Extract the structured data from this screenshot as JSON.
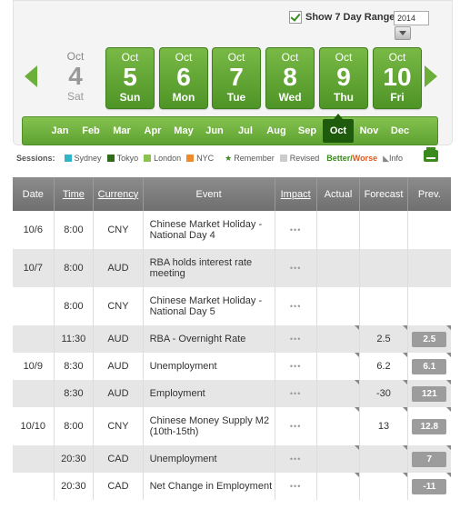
{
  "header": {
    "show7_label": "Show 7 Day Range",
    "year": "2014"
  },
  "days": [
    {
      "month": "Oct",
      "num": "4",
      "dow": "Sat",
      "active": false
    },
    {
      "month": "Oct",
      "num": "5",
      "dow": "Sun",
      "active": true
    },
    {
      "month": "Oct",
      "num": "6",
      "dow": "Mon",
      "active": true
    },
    {
      "month": "Oct",
      "num": "7",
      "dow": "Tue",
      "active": true
    },
    {
      "month": "Oct",
      "num": "8",
      "dow": "Wed",
      "active": true
    },
    {
      "month": "Oct",
      "num": "9",
      "dow": "Thu",
      "active": true
    },
    {
      "month": "Oct",
      "num": "10",
      "dow": "Fri",
      "active": true
    }
  ],
  "months": [
    "Jan",
    "Feb",
    "Mar",
    "Apr",
    "May",
    "Jun",
    "Jul",
    "Aug",
    "Sep",
    "Oct",
    "Nov",
    "Dec"
  ],
  "selected_month_index": 9,
  "legend": {
    "sessions_label": "Sessions:",
    "sessions": [
      {
        "name": "Sydney",
        "color": "#33b5c9"
      },
      {
        "name": "Tokyo",
        "color": "#2f6b1b"
      },
      {
        "name": "London",
        "color": "#8cc34f"
      },
      {
        "name": "NYC",
        "color": "#f08a2c"
      }
    ],
    "remember": "Remember",
    "revised": "Revised",
    "better": "Better",
    "slash": " / ",
    "worse": "Worse",
    "info": "Info"
  },
  "table": {
    "columns": [
      "Date",
      "Time",
      "Currency",
      "Event",
      "Impact",
      "Actual",
      "Forecast",
      "Prev."
    ],
    "rows": [
      {
        "date": "10/6",
        "time": "8:00",
        "currency": "CNY",
        "event": "Chinese Market Holiday - National Day 4",
        "impact": "•••",
        "actual": "",
        "forecast": "",
        "prev": ""
      },
      {
        "date": "10/7",
        "time": "8:00",
        "currency": "AUD",
        "event": "RBA holds interest rate meeting",
        "impact": "•••",
        "actual": "",
        "forecast": "",
        "prev": ""
      },
      {
        "date": "",
        "time": "8:00",
        "currency": "CNY",
        "event": "Chinese Market Holiday - National Day 5",
        "impact": "•••",
        "actual": "",
        "forecast": "",
        "prev": ""
      },
      {
        "date": "",
        "time": "11:30",
        "currency": "AUD",
        "event": "RBA - Overnight Rate",
        "impact": "•••",
        "actual": "",
        "forecast": "2.5",
        "prev": "2.5"
      },
      {
        "date": "10/9",
        "time": "8:30",
        "currency": "AUD",
        "event": "Unemployment",
        "impact": "•••",
        "actual": "",
        "forecast": "6.2",
        "prev": "6.1"
      },
      {
        "date": "",
        "time": "8:30",
        "currency": "AUD",
        "event": "Employment",
        "impact": "•••",
        "actual": "",
        "forecast": "-30",
        "prev": "121"
      },
      {
        "date": "10/10",
        "time": "8:00",
        "currency": "CNY",
        "event": "Chinese Money Supply M2 (10th-15th)",
        "impact": "•••",
        "actual": "",
        "forecast": "13",
        "prev": "12.8"
      },
      {
        "date": "",
        "time": "20:30",
        "currency": "CAD",
        "event": "Unemployment",
        "impact": "•••",
        "actual": "",
        "forecast": "",
        "prev": "7"
      },
      {
        "date": "",
        "time": "20:30",
        "currency": "CAD",
        "event": "Net Change in Employment",
        "impact": "•••",
        "actual": "",
        "forecast": "",
        "prev": "-11"
      }
    ]
  }
}
